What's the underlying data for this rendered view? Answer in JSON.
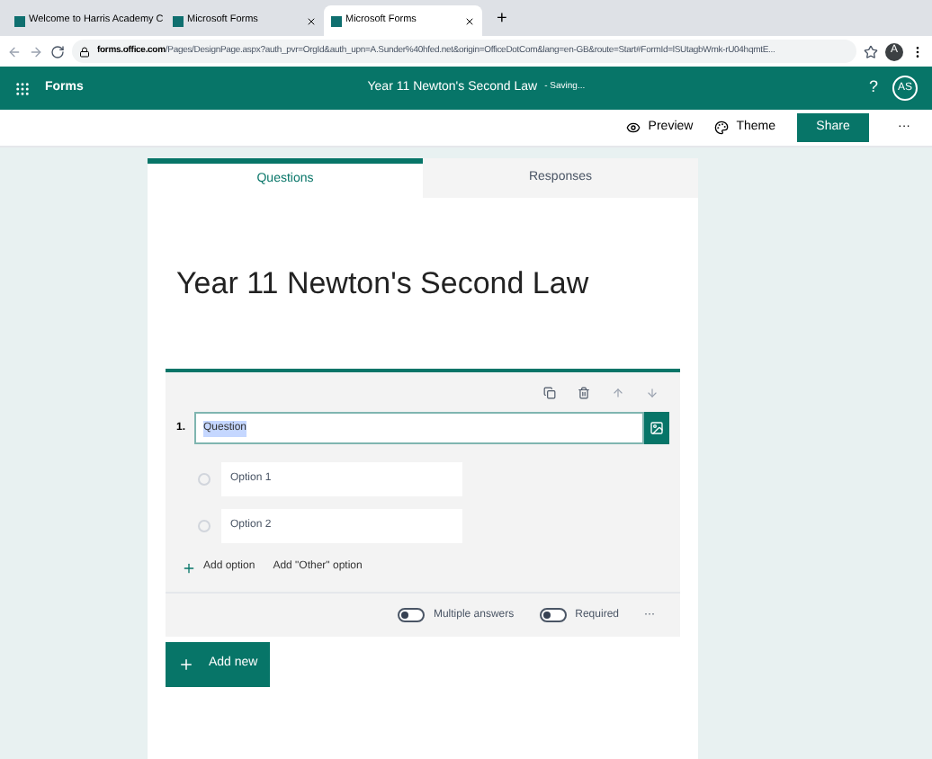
{
  "browser_tabs": [
    {
      "title": "Welcome to Harris Academy C",
      "selected": false
    },
    {
      "title": "Microsoft Forms",
      "selected": false
    },
    {
      "title": "Microsoft Forms",
      "selected": true
    }
  ],
  "new_tab": "+",
  "address": {
    "host": "forms.office.com",
    "path": "/Pages/DesignPage.aspx?auth_pvr=OrgId&auth_upn=A.Sunder%40hfed.net&origin=OfficeDotCom&lang=en-GB&route=Start#FormId=lSUtagbWmk-rU04hqmtE..."
  },
  "profile_initial": "A",
  "app": {
    "name": "Forms",
    "doc_title": "Year 11 Newton's Second Law",
    "status": "- Saving...",
    "help": "?",
    "avatar": "AS"
  },
  "toolbar": {
    "preview": "Preview",
    "theme": "Theme",
    "share": "Share",
    "more": "···"
  },
  "form_tabs": [
    {
      "label": "Questions",
      "selected": true
    },
    {
      "label": "Responses",
      "selected": false
    }
  ],
  "form_title": "Year 11 Newton's Second Law",
  "question": {
    "number": "1.",
    "text": "Question",
    "options": [
      {
        "label": "Option 1",
        "selected": false
      },
      {
        "label": "Option 2",
        "selected": false
      }
    ],
    "add_option": "Add option",
    "add_other": "Add \"Other\" option",
    "toggles": [
      {
        "label": "Multiple answers",
        "on": false
      },
      {
        "label": "Required",
        "on": false
      }
    ],
    "more": "···"
  },
  "add_new": "Add new"
}
